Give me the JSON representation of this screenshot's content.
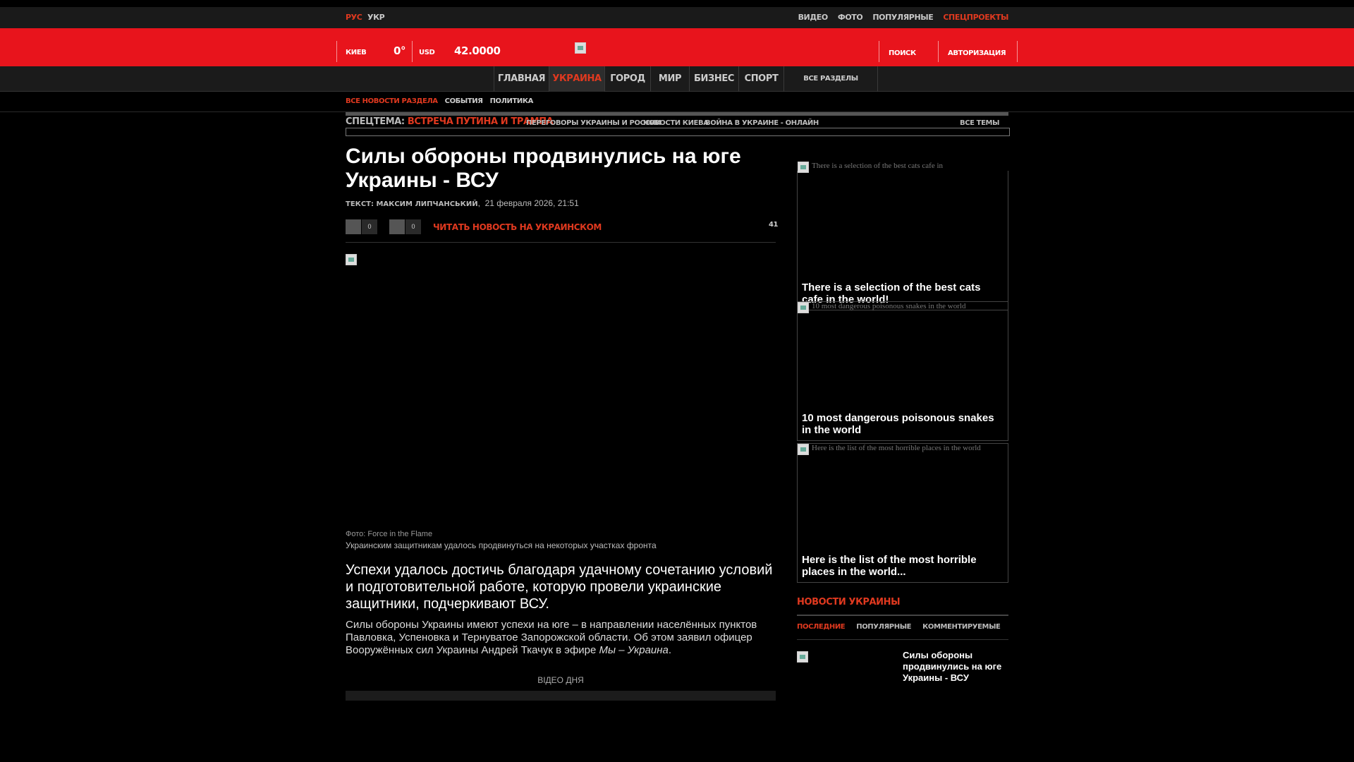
{
  "header": {
    "lang_ru": "РУС",
    "lang_ua": "УКР",
    "top_links": [
      "ВИДЕО",
      "ФОТО",
      "ПОПУЛЯРНЫЕ",
      "СПЕЦПРОЕКТЫ"
    ],
    "city": "КИЕВ",
    "temperature": "0°",
    "currency": "USD",
    "rate": "42.0000",
    "search": "ПОИСК",
    "auth": "АВТОРИЗАЦИЯ"
  },
  "nav": {
    "items": [
      "ГЛАВНАЯ",
      "УКРАИНА",
      "ГОРОД",
      "МИР",
      "БИЗНЕС",
      "СПОРТ"
    ],
    "all": "ВСЕ РАЗДЕЛЫ"
  },
  "subnav": [
    "ВСЕ НОВОСТИ РАЗДЕЛА",
    "СОБЫТИЯ",
    "ПОЛИТИКА"
  ],
  "special": {
    "label": "СПЕЦТЕМА:",
    "topic": "ВСТРЕЧА ПУТИНА И ТРАМПА",
    "links": [
      "ПЕРЕГОВОРЫ УКРАИНЫ И РОССИИ",
      "НОВОСТИ КИЕВА",
      "ВОЙНА В УКРАИНЕ - ОНЛАЙН"
    ],
    "all": "ВСЕ ТЕМЫ"
  },
  "article": {
    "title": "Силы обороны продвинулись на юге Украины - ВСУ",
    "author_label": "ТЕКСТ: МАКСИМ ЛИПЧАНСЬКИЙ",
    "date": "21 февраля 2026, 21:51",
    "share_count_1": "0",
    "share_count_2": "0",
    "read_ua": "ЧИТАТЬ НОВОСТЬ НА УКРАИНСКОМ",
    "views": "41",
    "photo_credit": "Фото: Force in the Flame",
    "photo_caption": "Украинским защитникам удалось продвинуться на некоторых участках фронта",
    "lead": "Успехи удалось достичь благодаря удачному сочетанию условий и подготовительной работе, которую провели украинские защитники, подчеркивают ВСУ.",
    "body_main": "Силы обороны Украины имеют успехи на юге – в направлении населённых пунктов Павловка, Успеновка и Тернуватое Запорожской области. Об этом заявил офицер Вооружённых сил Украины Андрей Ткачук в эфире ",
    "body_source": "Мы – Украина",
    "body_end": ".",
    "video_day": "ВІДЕО ДНЯ"
  },
  "promos": [
    {
      "alt": "There is a selection of the best cats cafe in",
      "title": "There is a selection of the best cats cafe in the world!"
    },
    {
      "alt": "10 most dangerous poisonous snakes in the world",
      "title": "10 most dangerous poisonous snakes in the world"
    },
    {
      "alt": "Here is the list of the most horrible places in the world",
      "title": "Here is the list of the most horrible places in the world..."
    }
  ],
  "sidebar": {
    "title": "НОВОСТИ УКРАИНЫ",
    "tabs": [
      "ПОСЛЕДНИЕ",
      "ПОПУЛЯРНЫЕ",
      "КОММЕНТИРУЕМЫЕ"
    ],
    "headline": "Силы обороны продвинулись на юге Украины - ВСУ"
  }
}
